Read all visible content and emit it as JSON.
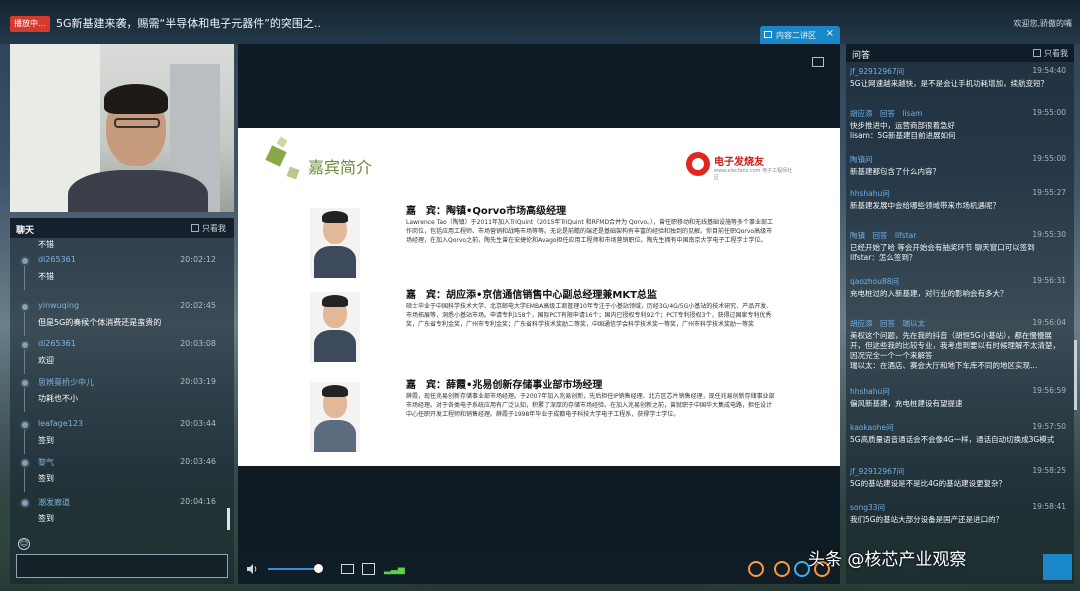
{
  "header": {
    "live_badge": "播放中...",
    "title": "5G新基建来袭，赐需“半导体和电子元器件”的突围之..",
    "welcome": "欢迎您,骄傲的嘴"
  },
  "stage": {
    "tab_label": "内容二讲区"
  },
  "chat": {
    "title": "聊天",
    "only_me": "只看我",
    "messages": [
      {
        "name": "",
        "time": "",
        "text": "不错"
      },
      {
        "name": "di265361",
        "time": "20:02:12",
        "text": "不错"
      },
      {
        "name": "yinwuqing",
        "time": "20:02:45",
        "text": "但是5G的奏候个体消费还是蛮贵的"
      },
      {
        "name": "di265361",
        "time": "20:03:08",
        "text": "欢迎"
      },
      {
        "name": "思辨莫桥少中儿",
        "time": "20:03:19",
        "text": "功耗也不小"
      },
      {
        "name": "leafage123",
        "time": "20:03:44",
        "text": "签到"
      },
      {
        "name": "黎气",
        "time": "20:03:46",
        "text": "签到"
      },
      {
        "name": "潮发廊道",
        "time": "20:04:16",
        "text": "签到"
      }
    ]
  },
  "slide": {
    "title": "嘉宾简介",
    "logo_text": "电子发烧友",
    "logo_sub": "www.elecfans.com 电子工程师社区",
    "guests": [
      {
        "name": "嘉　宾：陶镇•Qorvo市场高级经理",
        "desc": "Lawrence Tao（陶镇）于2011年加入TriQuint（2015年TriQuint 和RFMD合并为 Qorvo。），曾任职移动和无线基础设施等多个事业部工作岗位，包括应用工程师、市场营销和战略市场等等。无论是前瞻的端还是基础架构有丰富的经验和独到的见解。你目前任职Qorvo高级市场经理，在加入Qorvo之前，陶先生曾在安捷伦和Avago担任应用工程师和市场营销职位。陶先生拥有中国南京大学电子工程学士学位。"
      },
      {
        "name": "嘉　宾：胡应添•京信通信销售中心副总经理兼MKT总监",
        "desc": "硕士毕业于中国科学技术大学、北京邮电大学EMBA高级工商管理10年专注于小基站领域，历经3G/4G/5G小基站的技术研究、产品开发、市场拓展等，洞悉小基站市场。申请专利158个，国际PCT有限申请16个；国内已授权专利92个；PCT专利授权3个，获得过国家专利优秀奖，广东省专利金奖，广州市专利金奖；广东省科学技术奖励二等奖，中国通信学会科学技术奖一等奖，广州市科学技术奖励一等奖"
      },
      {
        "name": "嘉　宾：薛霞•兆易创新存储事业部市场经理",
        "desc": "薛霞，现任兆易创新存储事业部市场经理。于2007年加入兆易创新，先后担任IP销售经理、北方区芯片销售经理，现任兆易创新存储事业部市场经理。对于各类电子系统应用有广泛认知，积累了深厚的存储市场经验。在加入兆易创新之前，曾就职于中国华大集成电路，担任设计中心任职开发工程师和销售经理。薛霞于1998年毕业于成都电子科技大学电子工程系，获得学士学位。"
      }
    ]
  },
  "qa": {
    "title": "问答",
    "only_me": "只看我",
    "items": [
      {
        "hdr": "jf_92912967问",
        "time": "19:54:40",
        "text": "5G让网速越来越快，是不是会让手机功耗增加，续航变短？"
      },
      {
        "hdr": "胡应添　回答　lisam",
        "time": "19:55:00",
        "text": "快步推进中，运营商部很着急好\nlisam：5G新基建目前进展如何"
      },
      {
        "hdr": "陶镇问",
        "time": "19:55:00",
        "text": "新基建都包含了什么内容？"
      },
      {
        "hdr": "hhshahu问",
        "time": "19:55:27",
        "text": "新基建发展中会给哪些领域带来市场机遇呢？"
      },
      {
        "hdr": "陶镇　回答　llfstar",
        "time": "19:55:30",
        "text": "已经开始了哈 等会开始会有抽奖环节 聊天窗口可以签到\nllfstar：怎么签到？"
      },
      {
        "hdr": "qaozhou88问",
        "time": "19:56:31",
        "text": "充电桩过的入新基建，对行业的影响会有多大？"
      },
      {
        "hdr": "胡应添　回答　瑞以太",
        "time": "19:56:04",
        "text": "美权这个问题，先在我的抖音（胡恒5G小基站），都在慢慢展开，但这些我的比较专业，我考虑到要以有时候理解不太清楚，因况完全一个一个来解答\n瑞以太：在酒店、赛会大厅和地下车库不同的地区实现..."
      },
      {
        "hdr": "hhshahu问",
        "time": "19:56:59",
        "text": "偏风新基建，充电桩建设有望提速"
      },
      {
        "hdr": "kaokaohe问",
        "time": "19:57:50",
        "text": "5G高质量语音通话会不会像4G一样，通话自动切换成3G模式"
      },
      {
        "hdr": "jf_92912967问",
        "time": "19:58:25",
        "text": "5G的基站建设是不是比4G的基站建设更复杂？"
      },
      {
        "hdr": "song33问",
        "time": "19:58:41",
        "text": "我们5G的基站大部分设备是国产还是进口的？"
      }
    ]
  },
  "watermark": "头条 @核芯产业观察",
  "colors": {
    "accent": "#1a88c8",
    "live": "#d43a2e",
    "slide_title": "#6d8a3a",
    "signal": "#5fd24a"
  }
}
